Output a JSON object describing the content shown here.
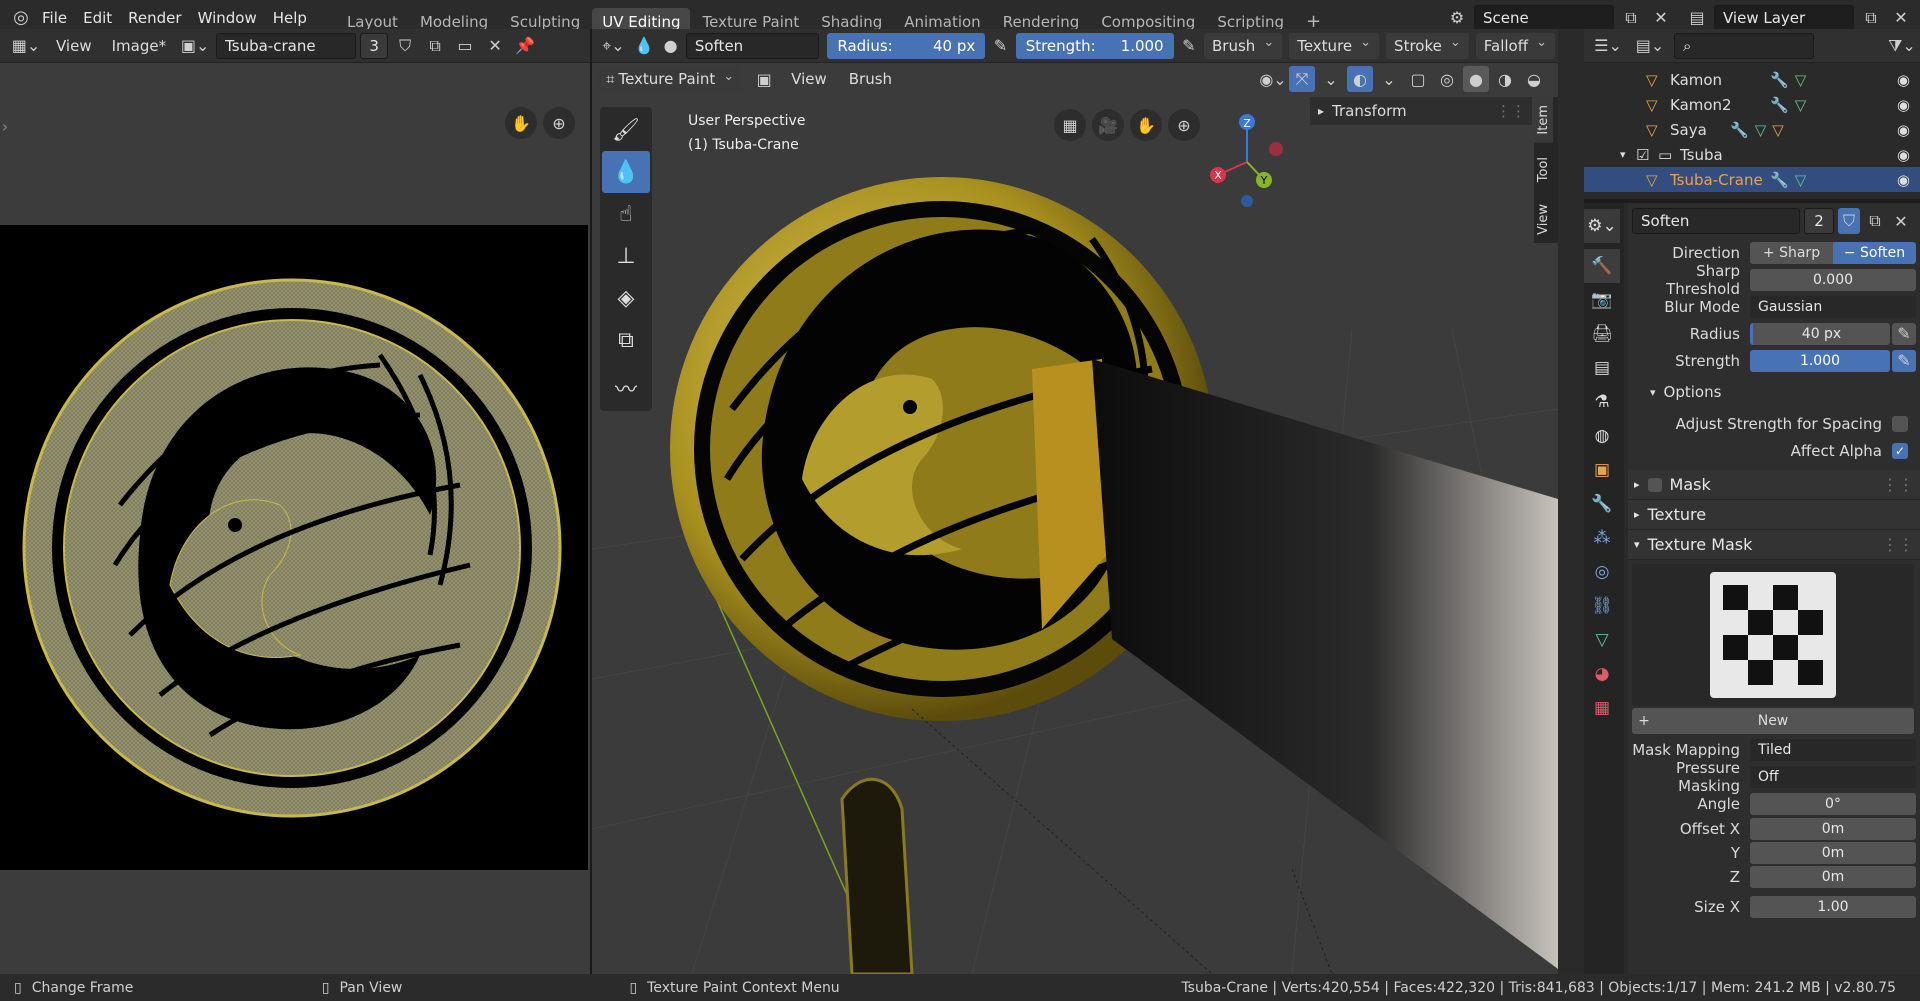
{
  "topbar": {
    "menus": [
      "File",
      "Edit",
      "Render",
      "Window",
      "Help"
    ],
    "workspaces": [
      "Layout",
      "Modeling",
      "Sculpting",
      "UV Editing",
      "Texture Paint",
      "Shading",
      "Animation",
      "Rendering",
      "Compositing",
      "Scripting"
    ],
    "active_workspace": "UV Editing",
    "scene": "Scene",
    "view_layer": "View Layer"
  },
  "uv_editor": {
    "menus": [
      "View",
      "Image*"
    ],
    "image_name": "Tsuba-crane",
    "users": "3"
  },
  "viewport": {
    "brush_name": "Soften",
    "radius_label": "Radius:",
    "radius_value": "40 px",
    "strength_label": "Strength:",
    "strength_value": "1.000",
    "header_menus": [
      "Brush",
      "Texture",
      "Stroke",
      "Falloff"
    ],
    "mode": "Texture Paint",
    "menus2": [
      "View",
      "Brush"
    ],
    "overlay_line1": "User Perspective",
    "overlay_line2": "(1) Tsuba-Crane",
    "npanel_title": "Transform",
    "side_tabs": [
      "Item",
      "Tool",
      "View"
    ],
    "gizmo": {
      "x": "X",
      "y": "Y",
      "z": "Z"
    }
  },
  "outliner": {
    "items": [
      {
        "name": "Kamon",
        "active": false
      },
      {
        "name": "Kamon2",
        "active": false
      },
      {
        "name": "Saya",
        "active": false
      },
      {
        "name": "Tsuba",
        "active": false
      },
      {
        "name": "Tsuba-Crane",
        "active": true
      }
    ]
  },
  "properties": {
    "brush_name": "Soften",
    "brush_users": "2",
    "direction_label": "Direction",
    "direction_sharp": "Sharp",
    "direction_soften": "Soften",
    "sharp_threshold_label": "Sharp Threshold",
    "sharp_threshold": "0.000",
    "blur_mode_label": "Blur Mode",
    "blur_mode": "Gaussian",
    "radius_label": "Radius",
    "radius": "40 px",
    "strength_label": "Strength",
    "strength": "1.000",
    "options_label": "Options",
    "adjust_strength_label": "Adjust Strength for Spacing",
    "adjust_strength": false,
    "affect_alpha_label": "Affect Alpha",
    "affect_alpha": true,
    "mask_label": "Mask",
    "texture_label": "Texture",
    "texture_mask_label": "Texture Mask",
    "new_button": "New",
    "mask_mapping_label": "Mask Mapping",
    "mask_mapping": "Tiled",
    "pressure_masking_label": "Pressure Masking",
    "pressure_masking": "Off",
    "angle_label": "Angle",
    "angle": "0°",
    "offset_x_label": "Offset X",
    "offset_x": "0m",
    "offset_y_label": "Y",
    "offset_y": "0m",
    "offset_z_label": "Z",
    "offset_z": "0m",
    "size_x_label": "Size X",
    "size_x": "1.00"
  },
  "status": {
    "left1": "Change Frame",
    "left2": "Pan View",
    "left3": "Texture Paint Context Menu",
    "stats": "Tsuba-Crane | Verts:420,554 | Faces:422,320 | Tris:841,683 | Objects:1/17 | Mem: 241.2 MB | v2.80.75"
  },
  "colors": {
    "accent": "#4772b3",
    "active_object": "#e9a449",
    "gold": "#c9ad2f"
  }
}
